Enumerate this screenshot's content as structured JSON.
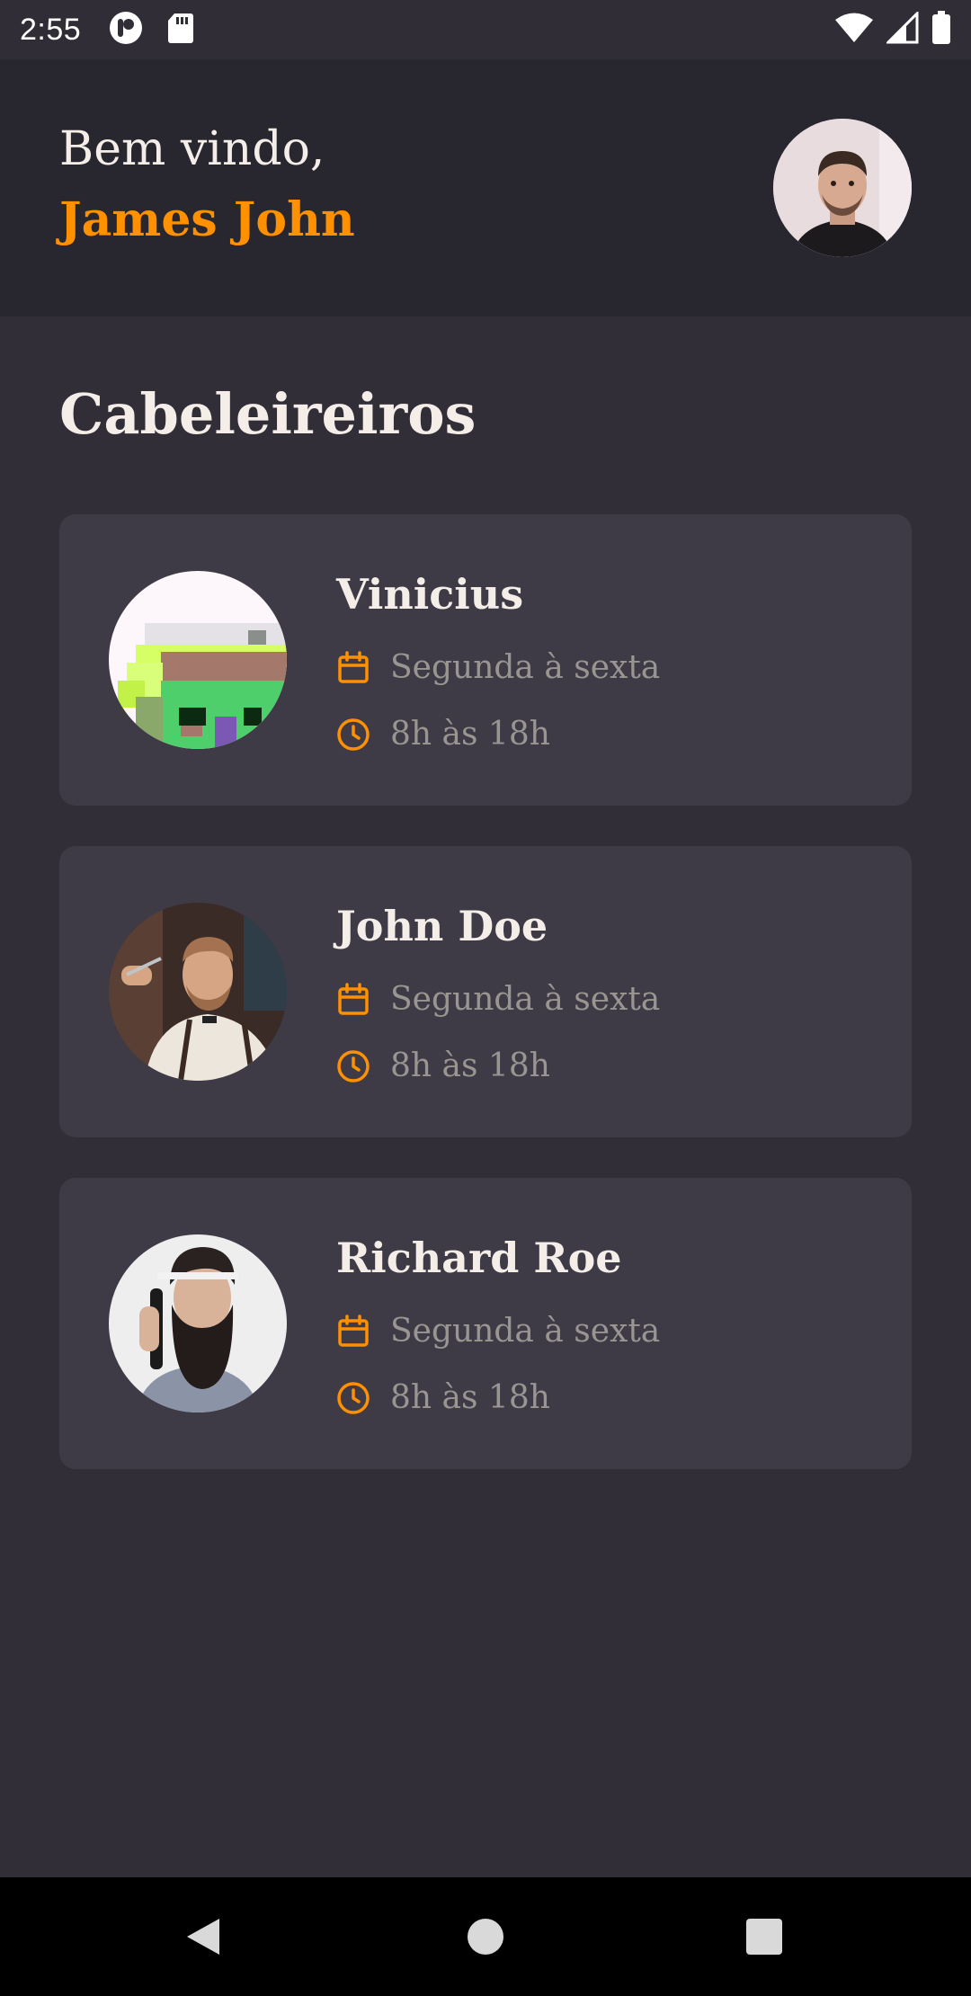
{
  "status_bar": {
    "time": "2:55",
    "icons": [
      "app-notification-icon",
      "sd-card-icon",
      "wifi-icon",
      "signal-icon",
      "battery-icon"
    ]
  },
  "header": {
    "welcome_text": "Bem vindo,",
    "user_name": "James John",
    "avatar_icon": "user-avatar"
  },
  "main": {
    "title": "Cabeleireiros",
    "providers": [
      {
        "name": "Vinicius",
        "days": "Segunda à sexta",
        "hours": "8h às 18h",
        "avatar": "pixel-art-avatar"
      },
      {
        "name": "John Doe",
        "days": "Segunda à sexta",
        "hours": "8h às 18h",
        "avatar": "barber-photo"
      },
      {
        "name": "Richard Roe",
        "days": "Segunda à sexta",
        "hours": "8h às 18h",
        "avatar": "bearded-man-photo"
      }
    ],
    "row_icons": {
      "days": "calendar-icon",
      "hours": "clock-icon"
    }
  },
  "nav_bar": {
    "buttons": [
      "back-icon",
      "home-icon",
      "recents-icon"
    ]
  },
  "colors": {
    "background": "#312e38",
    "header": "#28262e",
    "card": "#3e3b47",
    "accent": "#ff9000",
    "text": "#f4ede8",
    "muted_text": "#999591"
  }
}
